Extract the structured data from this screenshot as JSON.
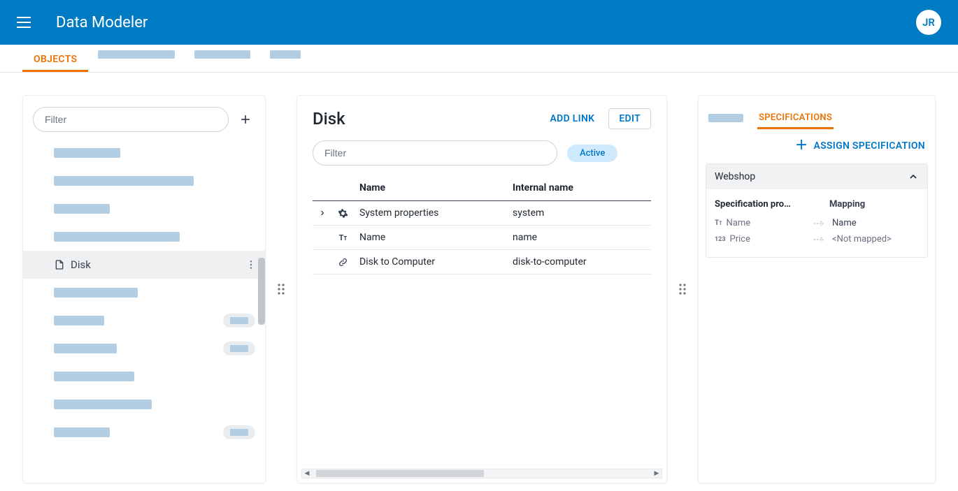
{
  "header": {
    "title": "Data Modeler",
    "avatar_initials": "JR"
  },
  "tabs": {
    "active": "OBJECTS"
  },
  "left": {
    "filter_placeholder": "Filter",
    "selected_label": "Disk"
  },
  "mid": {
    "title": "Disk",
    "add_link": "ADD LINK",
    "edit": "EDIT",
    "filter_placeholder": "Filter",
    "status": "Active",
    "columns": {
      "name": "Name",
      "internal": "Internal name"
    },
    "rows": [
      {
        "expandable": true,
        "icon": "gear",
        "name": "System properties",
        "internal": "system"
      },
      {
        "expandable": false,
        "icon": "text",
        "name": "Name",
        "internal": "name"
      },
      {
        "expandable": false,
        "icon": "link",
        "name": "Disk to Computer",
        "internal": "disk-to-computer"
      }
    ]
  },
  "right": {
    "tab_label": "SPECIFICATIONS",
    "assign": "ASSIGN SPECIFICATION",
    "spec_title": "Webshop",
    "columns": {
      "prop": "Specification pro…",
      "map": "Mapping"
    },
    "rows": [
      {
        "icon": "text",
        "prop": "Name",
        "mapping": "Name",
        "mapped": true
      },
      {
        "icon": "number",
        "prop": "Price",
        "mapping": "<Not mapped>",
        "mapped": false
      }
    ]
  }
}
